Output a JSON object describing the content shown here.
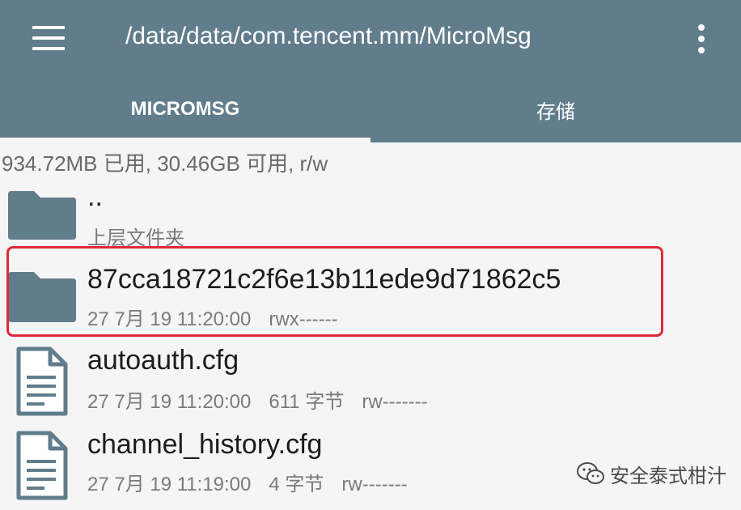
{
  "appbar": {
    "title": "/data/data/com.tencent.mm/MicroMsg",
    "menu_icon": "hamburger-menu-icon",
    "more_icon": "more-vertical-icon",
    "color": "#617d8c"
  },
  "tabs": [
    {
      "label": "MICROMSG",
      "active": true
    },
    {
      "label": "存储",
      "active": false
    }
  ],
  "storage_status": "934.72MB 已用, 30.46GB 可用, r/w",
  "files": [
    {
      "icon": "folder-icon",
      "name": "..",
      "date": "上层文件夹",
      "size": "",
      "perm": ""
    },
    {
      "icon": "folder-icon",
      "name": "87cca18721c2f6e13b11ede9d71862c5",
      "date": "27 7月 19 11:20:00",
      "size": "",
      "perm": "rwx------"
    },
    {
      "icon": "file-icon",
      "name": "autoauth.cfg",
      "date": "27 7月 19 11:20:00",
      "size": "611 字节",
      "perm": "rw-------"
    },
    {
      "icon": "file-icon",
      "name": "channel_history.cfg",
      "date": "27 7月 19 11:19:00",
      "size": "4 字节",
      "perm": "rw-------"
    }
  ],
  "highlight_color": "#e0283a",
  "watermark": {
    "text": "安全泰式柑汁",
    "icon": "wechat-icon"
  }
}
